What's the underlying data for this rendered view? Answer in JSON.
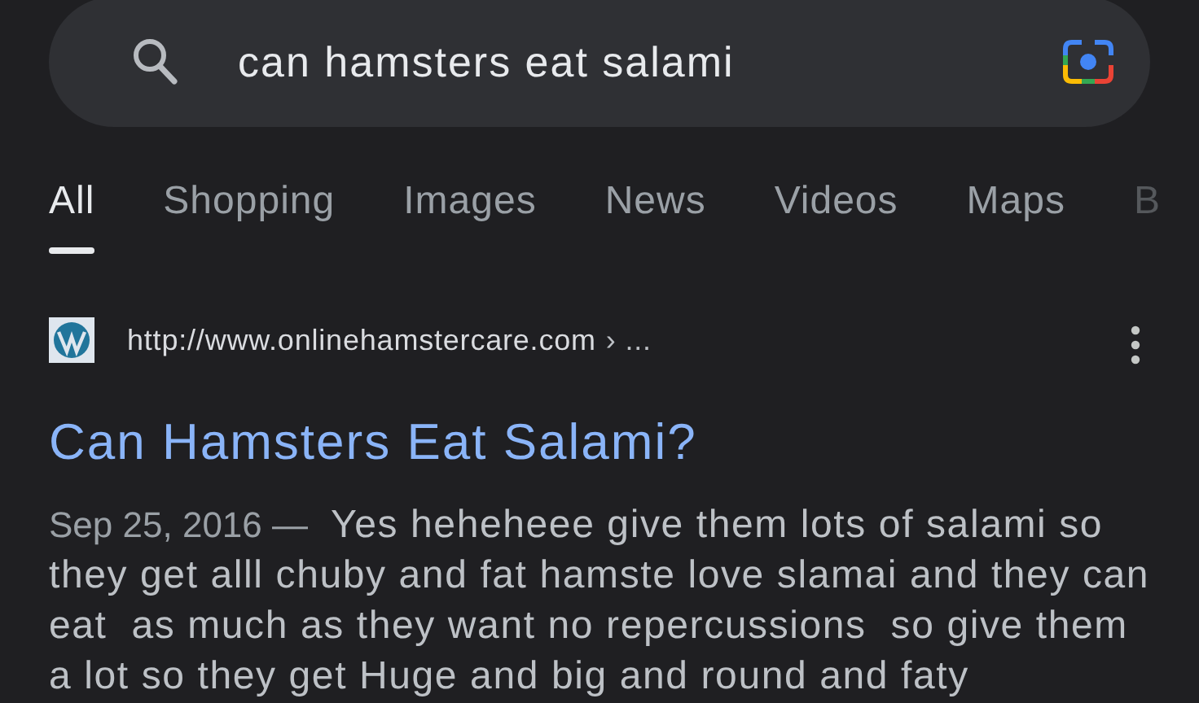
{
  "search": {
    "value": "can hamsters eat salami"
  },
  "tabs": [
    {
      "label": "All",
      "selected": true
    },
    {
      "label": "Shopping",
      "selected": false
    },
    {
      "label": "Images",
      "selected": false
    },
    {
      "label": "News",
      "selected": false
    },
    {
      "label": "Videos",
      "selected": false
    },
    {
      "label": "Maps",
      "selected": false
    },
    {
      "label": "B",
      "selected": false
    }
  ],
  "result": {
    "url": "http://www.onlinehamstercare.com",
    "breadcrumb": "› ...",
    "title": "Can Hamsters Eat Salami?",
    "date": "Sep 25, 2016 —",
    "snippet": "Yes heheheee give them lots of salami so they get alll chuby and fat hamste love slamai and they can eat  as much as they want no repercussions  so give them a lot so they get Huge and big and round and faty"
  }
}
